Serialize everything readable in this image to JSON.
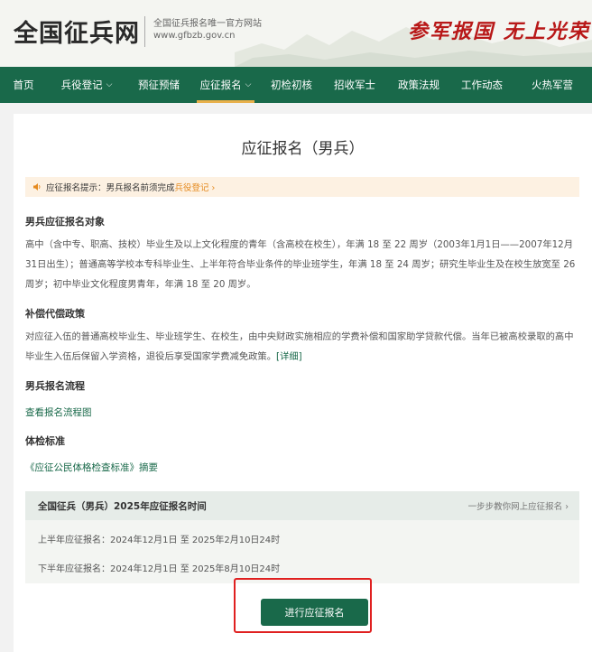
{
  "site": {
    "title": "全国征兵网",
    "subtitle": "全国征兵报名唯一官方网站",
    "url": "www.gfbzb.gov.cn",
    "slogan": "参军报国 无上光荣"
  },
  "nav": {
    "items": [
      {
        "label": "首页",
        "has_dropdown": false,
        "active": false
      },
      {
        "label": "兵役登记",
        "has_dropdown": true,
        "active": false
      },
      {
        "label": "预征预储",
        "has_dropdown": false,
        "active": false
      },
      {
        "label": "应征报名",
        "has_dropdown": true,
        "active": true
      },
      {
        "label": "初检初核",
        "has_dropdown": false,
        "active": false
      },
      {
        "label": "招收军士",
        "has_dropdown": false,
        "active": false
      },
      {
        "label": "政策法规",
        "has_dropdown": false,
        "active": false
      },
      {
        "label": "工作动态",
        "has_dropdown": false,
        "active": false
      },
      {
        "label": "火热军营",
        "has_dropdown": false,
        "active": false
      }
    ]
  },
  "page": {
    "title": "应征报名（男兵）",
    "notice_prefix": "应征报名提示：男兵报名前须完成",
    "notice_link": "兵役登记 ›",
    "sections": {
      "targets": {
        "heading": "男兵应征报名对象",
        "text": "高中（含中专、职高、技校）毕业生及以上文化程度的青年（含高校在校生），年满 18 至 22 周岁（2003年1月1日——2007年12月31日出生）；普通高等学校本专科毕业生、上半年符合毕业条件的毕业班学生，年满 18 至 24 周岁；研究生毕业生及在校生放宽至 26 周岁；初中毕业文化程度男青年，年满 18 至 20 周岁。"
      },
      "compensation": {
        "heading": "补偿代偿政策",
        "text": "对应征入伍的普通高校毕业生、毕业班学生、在校生，由中央财政实施相应的学费补偿和国家助学贷款代偿。当年已被高校录取的高中毕业生入伍后保留入学资格，退役后享受国家学费减免政策。",
        "detail_link": "[详细]"
      },
      "process": {
        "heading": "男兵报名流程",
        "link": "查看报名流程图"
      },
      "physical": {
        "heading": "体检标准",
        "link": "《应征公民体格检查标准》摘要"
      }
    },
    "schedule": {
      "title": "全国征兵（男兵）2025年应征报名时间",
      "guide": "一步步教你网上应征报名 ›",
      "first_half": "上半年应征报名：2024年12月1日 至 2025年2月10日24时",
      "second_half": "下半年应征报名：2024年12月1日 至 2025年8月10日24时"
    },
    "apply_button": "进行应征报名"
  },
  "colors": {
    "nav_green": "#19694a",
    "slogan_red": "#b81818",
    "notice_orange": "#e58a1f",
    "highlight_red": "#e02020"
  }
}
